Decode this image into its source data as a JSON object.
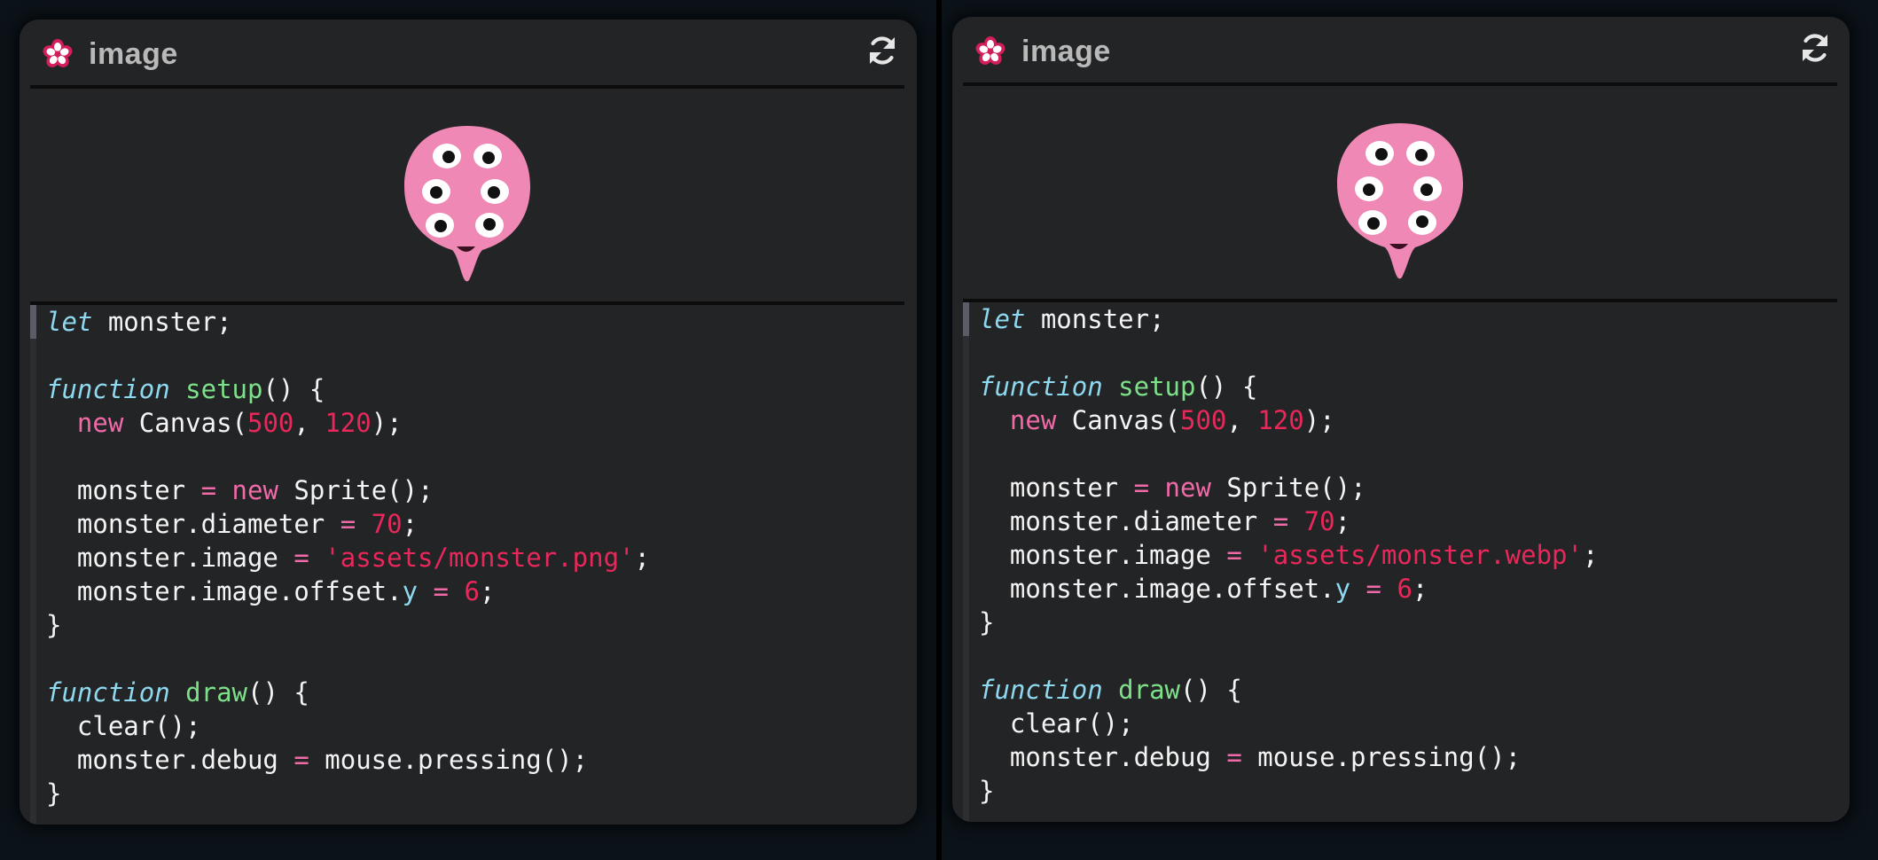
{
  "colors": {
    "background": "#060c10",
    "panel": "#232426",
    "title": "#b9b9b9",
    "keyword": "#8fd9f0",
    "function_name": "#7fe08a",
    "operator": "#f06aa8",
    "literal": "#e8285a",
    "monster": "#ef88b4"
  },
  "panels": [
    {
      "title": "image",
      "header_icon": "cherry-blossom-icon",
      "refresh_icon": "refresh-icon",
      "preview_image": "pink-monster-sprite",
      "code": [
        [
          [
            "kw",
            "let"
          ],
          [
            "txt",
            " monster;"
          ]
        ],
        [],
        [
          [
            "kw",
            "function"
          ],
          [
            "txt",
            " "
          ],
          [
            "fn",
            "setup"
          ],
          [
            "txt",
            "() {"
          ]
        ],
        [
          [
            "txt",
            "  "
          ],
          [
            "new",
            "new"
          ],
          [
            "txt",
            " Canvas("
          ],
          [
            "num",
            "500"
          ],
          [
            "txt",
            ", "
          ],
          [
            "num",
            "120"
          ],
          [
            "txt",
            ");"
          ]
        ],
        [],
        [
          [
            "txt",
            "  monster "
          ],
          [
            "op",
            "="
          ],
          [
            "txt",
            " "
          ],
          [
            "new",
            "new"
          ],
          [
            "txt",
            " Sprite();"
          ]
        ],
        [
          [
            "txt",
            "  monster.diameter "
          ],
          [
            "op",
            "="
          ],
          [
            "txt",
            " "
          ],
          [
            "num",
            "70"
          ],
          [
            "txt",
            ";"
          ]
        ],
        [
          [
            "txt",
            "  monster.image "
          ],
          [
            "op",
            "="
          ],
          [
            "txt",
            " "
          ],
          [
            "str",
            "'assets/monster.png'"
          ],
          [
            "txt",
            ";"
          ]
        ],
        [
          [
            "txt",
            "  monster.image.offset."
          ],
          [
            "prop",
            "y"
          ],
          [
            "txt",
            " "
          ],
          [
            "op",
            "="
          ],
          [
            "txt",
            " "
          ],
          [
            "num",
            "6"
          ],
          [
            "txt",
            ";"
          ]
        ],
        [
          [
            "txt",
            "}"
          ]
        ],
        [],
        [
          [
            "kw",
            "function"
          ],
          [
            "txt",
            " "
          ],
          [
            "fn",
            "draw"
          ],
          [
            "txt",
            "() {"
          ]
        ],
        [
          [
            "txt",
            "  clear();"
          ]
        ],
        [
          [
            "txt",
            "  monster.debug "
          ],
          [
            "op",
            "="
          ],
          [
            "txt",
            " mouse.pressing();"
          ]
        ],
        [
          [
            "txt",
            "}"
          ]
        ]
      ]
    },
    {
      "title": "image",
      "header_icon": "cherry-blossom-icon",
      "refresh_icon": "refresh-icon",
      "preview_image": "pink-monster-sprite",
      "code": [
        [
          [
            "kw",
            "let"
          ],
          [
            "txt",
            " monster;"
          ]
        ],
        [],
        [
          [
            "kw",
            "function"
          ],
          [
            "txt",
            " "
          ],
          [
            "fn",
            "setup"
          ],
          [
            "txt",
            "() {"
          ]
        ],
        [
          [
            "txt",
            "  "
          ],
          [
            "new",
            "new"
          ],
          [
            "txt",
            " Canvas("
          ],
          [
            "num",
            "500"
          ],
          [
            "txt",
            ", "
          ],
          [
            "num",
            "120"
          ],
          [
            "txt",
            ");"
          ]
        ],
        [],
        [
          [
            "txt",
            "  monster "
          ],
          [
            "op",
            "="
          ],
          [
            "txt",
            " "
          ],
          [
            "new",
            "new"
          ],
          [
            "txt",
            " Sprite();"
          ]
        ],
        [
          [
            "txt",
            "  monster.diameter "
          ],
          [
            "op",
            "="
          ],
          [
            "txt",
            " "
          ],
          [
            "num",
            "70"
          ],
          [
            "txt",
            ";"
          ]
        ],
        [
          [
            "txt",
            "  monster.image "
          ],
          [
            "op",
            "="
          ],
          [
            "txt",
            " "
          ],
          [
            "str",
            "'assets/monster.webp'"
          ],
          [
            "txt",
            ";"
          ]
        ],
        [
          [
            "txt",
            "  monster.image.offset."
          ],
          [
            "prop",
            "y"
          ],
          [
            "txt",
            " "
          ],
          [
            "op",
            "="
          ],
          [
            "txt",
            " "
          ],
          [
            "num",
            "6"
          ],
          [
            "txt",
            ";"
          ]
        ],
        [
          [
            "txt",
            "}"
          ]
        ],
        [],
        [
          [
            "kw",
            "function"
          ],
          [
            "txt",
            " "
          ],
          [
            "fn",
            "draw"
          ],
          [
            "txt",
            "() {"
          ]
        ],
        [
          [
            "txt",
            "  clear();"
          ]
        ],
        [
          [
            "txt",
            "  monster.debug "
          ],
          [
            "op",
            "="
          ],
          [
            "txt",
            " mouse.pressing();"
          ]
        ],
        [
          [
            "txt",
            "}"
          ]
        ]
      ]
    }
  ]
}
